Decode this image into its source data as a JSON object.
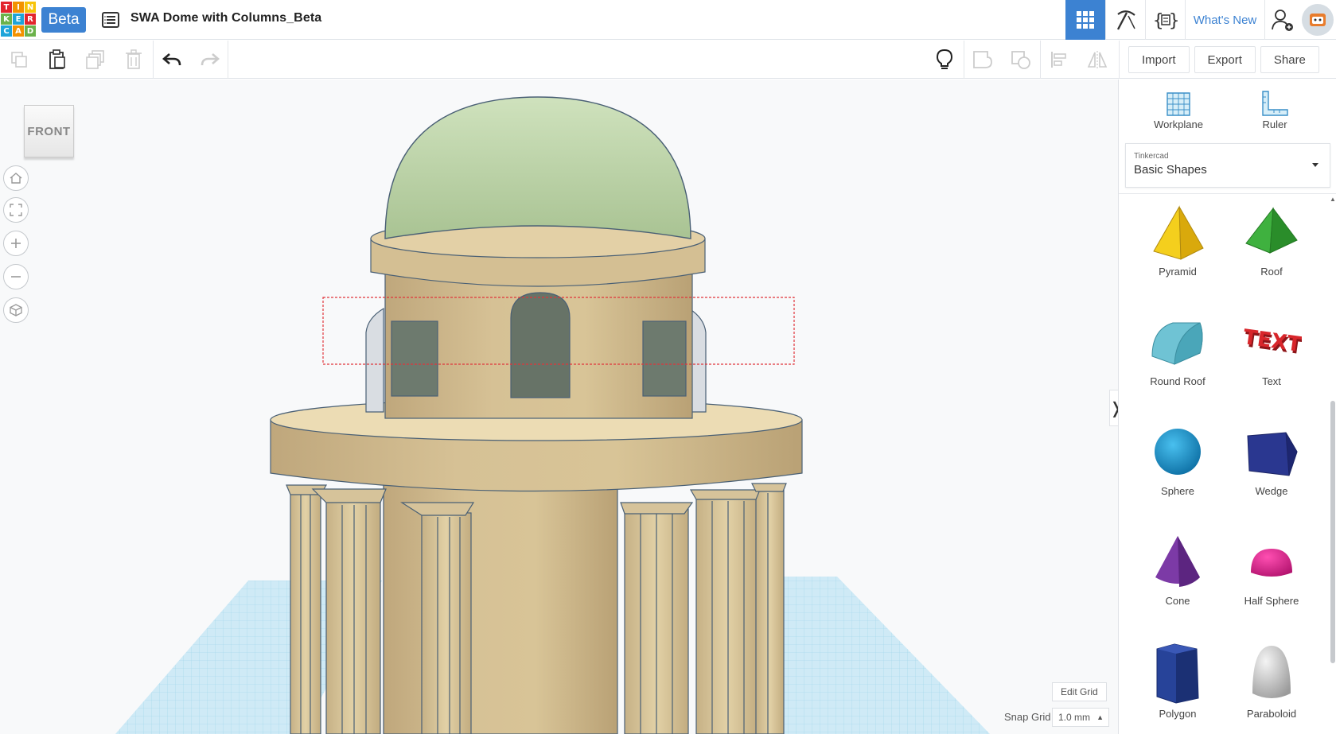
{
  "app": {
    "logo_letters": [
      "T",
      "I",
      "N",
      "K",
      "E",
      "R",
      "C",
      "A",
      "D"
    ],
    "logo_colors": [
      "#e2252d",
      "#f39200",
      "#f7c40a",
      "#6bb24b",
      "#1ea4d9",
      "#e2252d",
      "#1ea4d9",
      "#f39200",
      "#6bb24b"
    ],
    "beta_label": "Beta",
    "document_title": "SWA Dome with Columns_Beta"
  },
  "header": {
    "whats_new": "What's New",
    "accent": "#3c82d2"
  },
  "toolbar": {
    "import_label": "Import",
    "export_label": "Export",
    "share_label": "Share"
  },
  "viewport": {
    "view_cube_label": "FRONT",
    "edit_grid_label": "Edit Grid",
    "snap_grid_label": "Snap Grid",
    "snap_grid_value": "1.0 mm"
  },
  "panel": {
    "tools": [
      {
        "label": "Workplane",
        "icon": "workplane-icon"
      },
      {
        "label": "Ruler",
        "icon": "ruler-icon"
      }
    ],
    "library_source": "Tinkercad",
    "library_name": "Basic Shapes",
    "shapes": [
      {
        "label": "Pyramid",
        "color": "#f1c40f"
      },
      {
        "label": "Roof",
        "color": "#3cae3c"
      },
      {
        "label": "Round Roof",
        "color": "#5bb5c8"
      },
      {
        "label": "Text",
        "color": "#d8262b",
        "glyph": "TEXT"
      },
      {
        "label": "Sphere",
        "color": "#1d9bd7"
      },
      {
        "label": "Wedge",
        "color": "#27338a"
      },
      {
        "label": "Cone",
        "color": "#7c3aa6"
      },
      {
        "label": "Half Sphere",
        "color": "#e0198c"
      },
      {
        "label": "Polygon",
        "color": "#1f3f8c"
      },
      {
        "label": "Paraboloid",
        "color": "#d0d0d0"
      }
    ]
  }
}
